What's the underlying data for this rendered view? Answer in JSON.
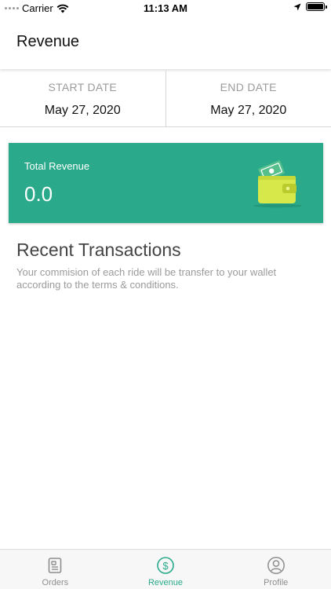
{
  "status_bar": {
    "carrier": "Carrier",
    "time": "11:13 AM"
  },
  "header": {
    "title": "Revenue"
  },
  "date_range": {
    "start_label": "START DATE",
    "start_value": "May 27, 2020",
    "end_label": "END DATE",
    "end_value": "May 27, 2020"
  },
  "revenue_card": {
    "label": "Total Revenue",
    "value": "0.0",
    "color": "#2aaa8a",
    "icon": "wallet-icon"
  },
  "recent_transactions": {
    "title": "Recent Transactions",
    "description": "Your commision of each ride will be transfer to your wallet according to the terms & conditions."
  },
  "tab_bar": {
    "accent_color": "#2aaa8a",
    "tabs": [
      {
        "label": "Orders",
        "icon": "orders-icon",
        "active": false
      },
      {
        "label": "Revenue",
        "icon": "dollar-circle-icon",
        "active": true
      },
      {
        "label": "Profile",
        "icon": "profile-icon",
        "active": false
      }
    ]
  }
}
